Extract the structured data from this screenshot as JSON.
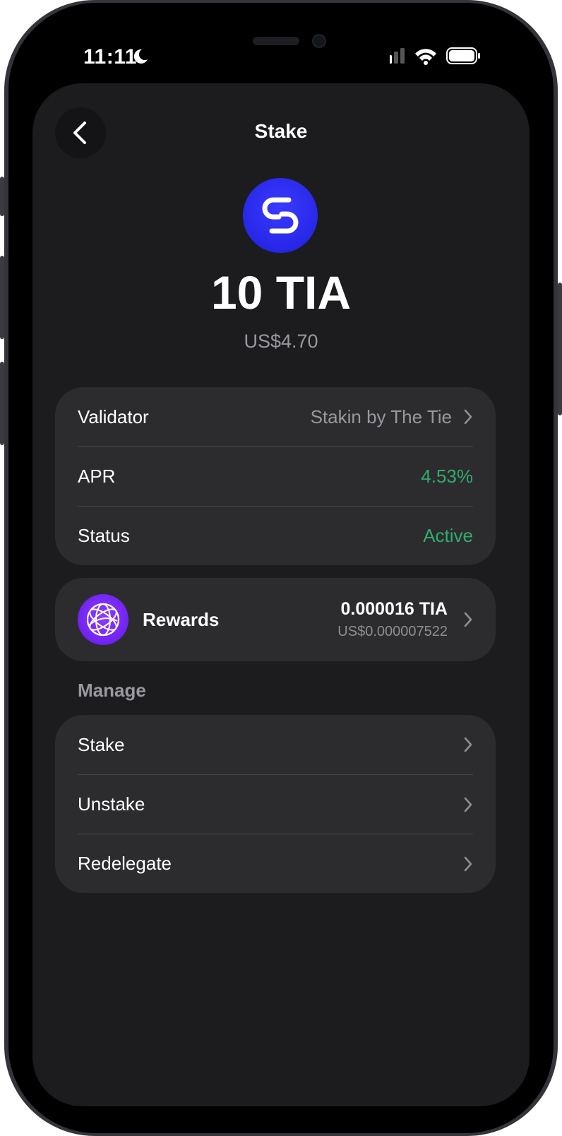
{
  "status_bar": {
    "time": "11:11"
  },
  "header": {
    "title": "Stake"
  },
  "token": {
    "amount": "10 TIA",
    "fiat": "US$4.70",
    "logo_icon": "stakin-s-icon",
    "accent": "#2727e8"
  },
  "details": [
    {
      "label": "Validator",
      "value": "Stakin by The Tie",
      "has_chevron": true
    },
    {
      "label": "APR",
      "value": "4.53%",
      "color": "#2fad6f"
    },
    {
      "label": "Status",
      "value": "Active",
      "color": "#2fad6f"
    }
  ],
  "rewards": {
    "label": "Rewards",
    "amount": "0.000016 TIA",
    "fiat": "US$0.000007522",
    "icon": "celestia-globe-icon",
    "accent": "#7a2cf5"
  },
  "manage": {
    "section_label": "Manage",
    "items": [
      {
        "label": "Stake"
      },
      {
        "label": "Unstake"
      },
      {
        "label": "Redelegate"
      }
    ]
  }
}
